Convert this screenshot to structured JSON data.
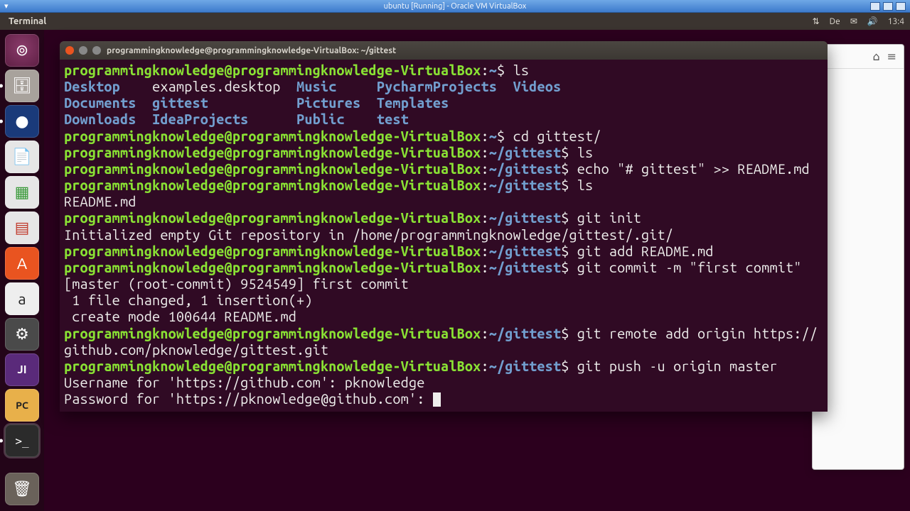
{
  "vbox": {
    "title": "ubuntu [Running] - Oracle VM VirtualBox"
  },
  "panel": {
    "app": "Terminal",
    "lang": "De",
    "time": "13:4"
  },
  "launcher": {
    "items": [
      {
        "name": "dash",
        "glyph": "◌"
      },
      {
        "name": "files",
        "glyph": "🗄"
      },
      {
        "name": "firefox",
        "glyph": "🦊"
      },
      {
        "name": "writer",
        "glyph": "📄"
      },
      {
        "name": "calc",
        "glyph": "▦"
      },
      {
        "name": "impress",
        "glyph": "▤"
      },
      {
        "name": "software",
        "glyph": "A"
      },
      {
        "name": "amazon",
        "glyph": "a"
      },
      {
        "name": "settings",
        "glyph": "⚙"
      },
      {
        "name": "ide",
        "glyph": "JI"
      },
      {
        "name": "pycharm",
        "glyph": "PC"
      },
      {
        "name": "terminal",
        "glyph": ">_"
      },
      {
        "name": "trash",
        "glyph": "🗑"
      }
    ]
  },
  "terminal": {
    "title": "programmingknowledge@programmingknowledge-VirtualBox: ~/gittest",
    "user_host": "programmingknowledge@programmingknowledge-VirtualBox",
    "home_path": "~",
    "gittest_path": "~/gittest",
    "ls_cmd": "ls",
    "ls_row1": {
      "c1": "Desktop",
      "c2": "examples.desktop",
      "c3": "Music",
      "c4": "PycharmProjects",
      "c5": "Videos"
    },
    "ls_row2": {
      "c1": "Documents",
      "c2": "gittest",
      "c3": "Pictures",
      "c4": "Templates"
    },
    "ls_row3": {
      "c1": "Downloads",
      "c2": "IdeaProjects",
      "c3": "Public",
      "c4": "test"
    },
    "cd_cmd": "cd gittest/",
    "ls2_cmd": "ls",
    "echo_cmd": "echo \"# gittest\" >> README.md",
    "ls3_cmd": "ls",
    "ls3_out": "README.md",
    "gitinit_cmd": "git init",
    "gitinit_out": "Initialized empty Git repository in /home/programmingknowledge/gittest/.git/",
    "gitadd_cmd": "git add README.md",
    "gitcommit_cmd": "git commit -m \"first commit\"",
    "commit_l1": "[master (root-commit) 9524549] first commit",
    "commit_l2": " 1 file changed, 1 insertion(+)",
    "commit_l3": " create mode 100644 README.md",
    "remote_cmd": "git remote add origin https://github.com/pknowledge/gittest.git",
    "push_cmd": "git push -u origin master",
    "user_prompt": "Username for 'https://github.com': ",
    "user_val": "pknowledge",
    "pass_prompt": "Password for 'https://pknowledge@github.com': "
  }
}
